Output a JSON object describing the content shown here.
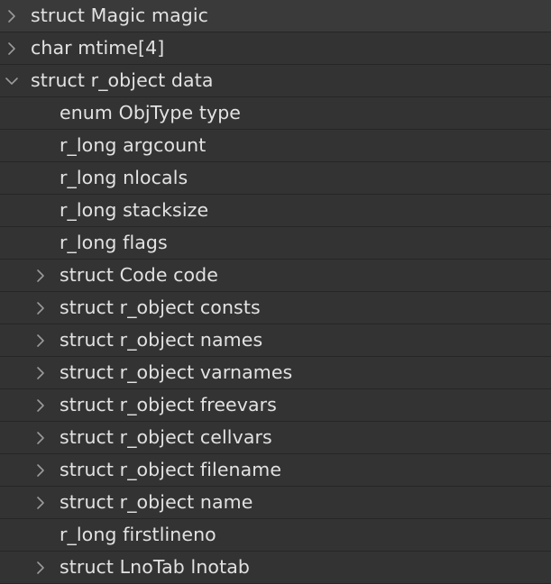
{
  "tree": {
    "rows": [
      {
        "label": "struct Magic magic",
        "level": 0,
        "toggle": "collapsed"
      },
      {
        "label": "char mtime[4]",
        "level": 0,
        "toggle": "collapsed"
      },
      {
        "label": "struct r_object data",
        "level": 0,
        "toggle": "expanded"
      },
      {
        "label": "enum ObjType type",
        "level": 1,
        "toggle": "none"
      },
      {
        "label": "r_long argcount",
        "level": 1,
        "toggle": "none"
      },
      {
        "label": "r_long nlocals",
        "level": 1,
        "toggle": "none"
      },
      {
        "label": "r_long stacksize",
        "level": 1,
        "toggle": "none"
      },
      {
        "label": "r_long flags",
        "level": 1,
        "toggle": "none"
      },
      {
        "label": "struct Code code",
        "level": 1,
        "toggle": "collapsed"
      },
      {
        "label": "struct r_object consts",
        "level": 1,
        "toggle": "collapsed"
      },
      {
        "label": "struct r_object names",
        "level": 1,
        "toggle": "collapsed"
      },
      {
        "label": "struct r_object varnames",
        "level": 1,
        "toggle": "collapsed"
      },
      {
        "label": "struct r_object freevars",
        "level": 1,
        "toggle": "collapsed"
      },
      {
        "label": "struct r_object cellvars",
        "level": 1,
        "toggle": "collapsed"
      },
      {
        "label": "struct r_object filename",
        "level": 1,
        "toggle": "collapsed"
      },
      {
        "label": "struct r_object name",
        "level": 1,
        "toggle": "collapsed"
      },
      {
        "label": "r_long firstlineno",
        "level": 1,
        "toggle": "none"
      },
      {
        "label": "struct LnoTab lnotab",
        "level": 1,
        "toggle": "collapsed"
      }
    ]
  },
  "icons": {
    "collapsed": "chevron-right-icon",
    "expanded": "chevron-down-icon"
  },
  "colors": {
    "background": "#333333",
    "separator": "#262626",
    "text": "#e2e2e2",
    "chevron": "#9a9a9a"
  }
}
